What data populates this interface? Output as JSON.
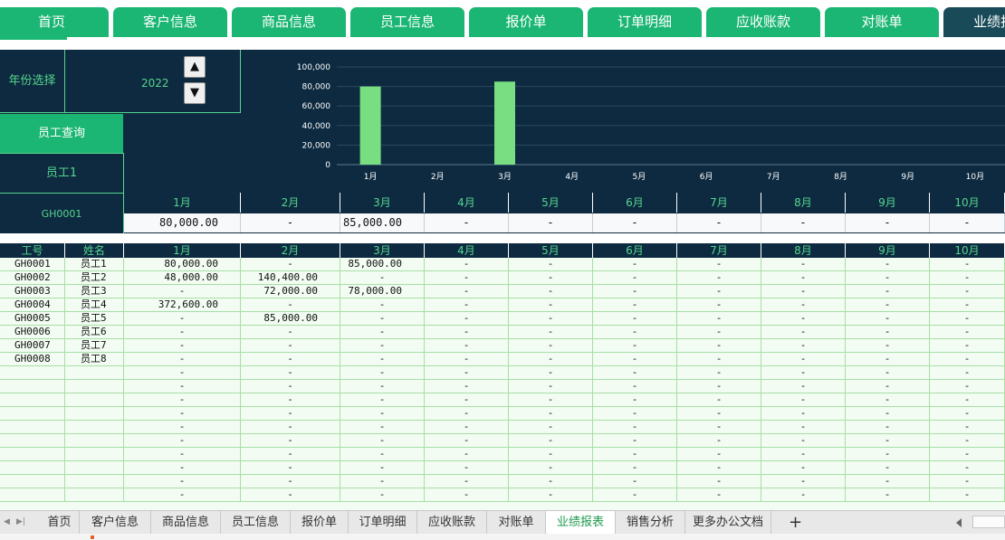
{
  "nav": {
    "tabs": [
      "首页",
      "客户信息",
      "商品信息",
      "员工信息",
      "报价单",
      "订单明细",
      "应收账款",
      "对账单",
      "业绩报表"
    ],
    "active_index": 8
  },
  "panel": {
    "year_label": "年份选择",
    "year_value": "2022",
    "up_arrow": "▲",
    "down_arrow": "▼",
    "employee_query_label": "员工查询",
    "employee_selected": "员工1",
    "employee_id": "GH0001"
  },
  "chart_data": {
    "type": "bar",
    "categories": [
      "1月",
      "2月",
      "3月",
      "4月",
      "5月",
      "6月",
      "7月",
      "8月",
      "9月",
      "10月"
    ],
    "values": [
      80000,
      0,
      85000,
      0,
      0,
      0,
      0,
      0,
      0,
      0
    ],
    "ylim": [
      0,
      100000
    ],
    "yticks": [
      "0",
      "20,000",
      "40,000",
      "60,000",
      "80,000",
      "100,000"
    ],
    "grid": true,
    "colors": {
      "bar": "#79dd81",
      "background": "#0d2a40",
      "grid": "#2a4a60",
      "text": "#ffffff"
    }
  },
  "summary": {
    "months": [
      "1月",
      "2月",
      "3月",
      "4月",
      "5月",
      "6月",
      "7月",
      "8月",
      "9月",
      "10月"
    ],
    "values": [
      "80,000.00",
      "-",
      "85,000.00",
      "-",
      "-",
      "-",
      "-",
      "-",
      "-",
      "-"
    ]
  },
  "table": {
    "headers": [
      "工号",
      "姓名",
      "1月",
      "2月",
      "3月",
      "4月",
      "5月",
      "6月",
      "7月",
      "8月",
      "9月",
      "10月"
    ],
    "rows": [
      [
        "GH0001",
        "员工1",
        "80,000.00",
        "-",
        "85,000.00",
        "-",
        "-",
        "-",
        "-",
        "-",
        "-",
        "-"
      ],
      [
        "GH0002",
        "员工2",
        "48,000.00",
        "140,400.00",
        "-",
        "-",
        "-",
        "-",
        "-",
        "-",
        "-",
        "-"
      ],
      [
        "GH0003",
        "员工3",
        "-",
        "72,000.00",
        "78,000.00",
        "-",
        "-",
        "-",
        "-",
        "-",
        "-",
        "-"
      ],
      [
        "GH0004",
        "员工4",
        "372,600.00",
        "-",
        "-",
        "-",
        "-",
        "-",
        "-",
        "-",
        "-",
        "-"
      ],
      [
        "GH0005",
        "员工5",
        "-",
        "85,000.00",
        "-",
        "-",
        "-",
        "-",
        "-",
        "-",
        "-",
        "-"
      ],
      [
        "GH0006",
        "员工6",
        "-",
        "-",
        "-",
        "-",
        "-",
        "-",
        "-",
        "-",
        "-",
        "-"
      ],
      [
        "GH0007",
        "员工7",
        "-",
        "-",
        "-",
        "-",
        "-",
        "-",
        "-",
        "-",
        "-",
        "-"
      ],
      [
        "GH0008",
        "员工8",
        "-",
        "-",
        "-",
        "-",
        "-",
        "-",
        "-",
        "-",
        "-",
        "-"
      ],
      [
        "",
        "",
        "-",
        "-",
        "-",
        "-",
        "-",
        "-",
        "-",
        "-",
        "-",
        "-"
      ],
      [
        "",
        "",
        "-",
        "-",
        "-",
        "-",
        "-",
        "-",
        "-",
        "-",
        "-",
        "-"
      ],
      [
        "",
        "",
        "-",
        "-",
        "-",
        "-",
        "-",
        "-",
        "-",
        "-",
        "-",
        "-"
      ],
      [
        "",
        "",
        "-",
        "-",
        "-",
        "-",
        "-",
        "-",
        "-",
        "-",
        "-",
        "-"
      ],
      [
        "",
        "",
        "-",
        "-",
        "-",
        "-",
        "-",
        "-",
        "-",
        "-",
        "-",
        "-"
      ],
      [
        "",
        "",
        "-",
        "-",
        "-",
        "-",
        "-",
        "-",
        "-",
        "-",
        "-",
        "-"
      ],
      [
        "",
        "",
        "-",
        "-",
        "-",
        "-",
        "-",
        "-",
        "-",
        "-",
        "-",
        "-"
      ],
      [
        "",
        "",
        "-",
        "-",
        "-",
        "-",
        "-",
        "-",
        "-",
        "-",
        "-",
        "-"
      ],
      [
        "",
        "",
        "-",
        "-",
        "-",
        "-",
        "-",
        "-",
        "-",
        "-",
        "-",
        "-"
      ],
      [
        "",
        "",
        "-",
        "-",
        "-",
        "-",
        "-",
        "-",
        "-",
        "-",
        "-",
        "-"
      ]
    ]
  },
  "sheet_tabs": {
    "items": [
      "首页",
      "客户信息",
      "商品信息",
      "员工信息",
      "报价单",
      "订单明细",
      "应收账款",
      "对账单",
      "业绩报表",
      "销售分析",
      "更多办公文档"
    ],
    "active_index": 8,
    "add_label": "+",
    "nav_prev": "◀",
    "nav_last": "▶|"
  }
}
